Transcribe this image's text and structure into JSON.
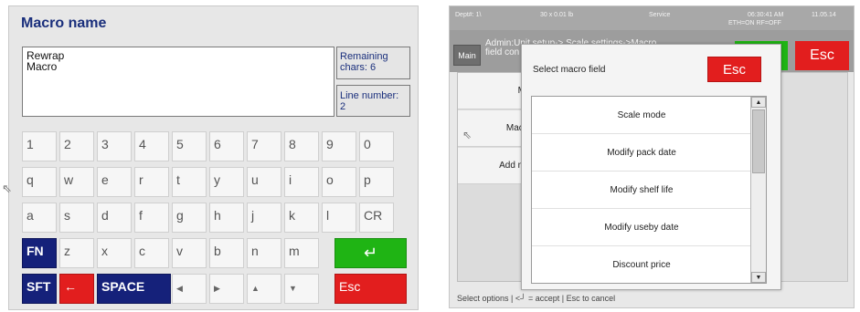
{
  "left": {
    "title": "Macro name",
    "text_lines": [
      "Rewrap",
      "Macro"
    ],
    "remaining_label": "Remaining chars: 6",
    "line_number_label": "Line number: 2",
    "keys": {
      "row1": [
        "1",
        "2",
        "3",
        "4",
        "5",
        "6",
        "7",
        "8",
        "9",
        "0"
      ],
      "row2": [
        "q",
        "w",
        "e",
        "r",
        "t",
        "y",
        "u",
        "i",
        "o",
        "p"
      ],
      "row3": [
        "a",
        "s",
        "d",
        "f",
        "g",
        "h",
        "j",
        "k",
        "l",
        "CR"
      ],
      "row4": [
        "FN",
        "z",
        "x",
        "c",
        "v",
        "b",
        "n",
        "m"
      ],
      "enter": "↵",
      "sft": "SFT",
      "backspace": "←",
      "space": "SPACE",
      "left_arrow": "◀",
      "right_arrow": "▶",
      "up_arrow": "▲",
      "down_arrow": "▼",
      "esc": "Esc"
    }
  },
  "right": {
    "status": {
      "dept": "Dept#: 1\\",
      "weight": "30 x 0.01 lb",
      "mode": "Service",
      "time": "06:30:41 AM",
      "date": "11.05.14",
      "net": "ETH=ON RF=OFF"
    },
    "main_button": "Main",
    "admin_line1": "Admin:Unit setup-> Scale settings->Macro",
    "admin_line2": "field con",
    "bg_esc": "Esc",
    "bg_enter": "↵",
    "bg_rows": [
      "M",
      "Maci",
      "Add m"
    ],
    "dialog": {
      "title": "Select macro field",
      "esc_label": "Esc",
      "options": [
        "Scale mode",
        "Modify pack date",
        "Modify shelf life",
        "Modify useby date",
        "Discount price"
      ]
    },
    "hint": "Select options | <┘ = accept | Esc to cancel"
  },
  "colors": {
    "navy": "#15217a",
    "green": "#1fb414",
    "red": "#e21e1e",
    "title_blue": "#1a2f7c"
  }
}
